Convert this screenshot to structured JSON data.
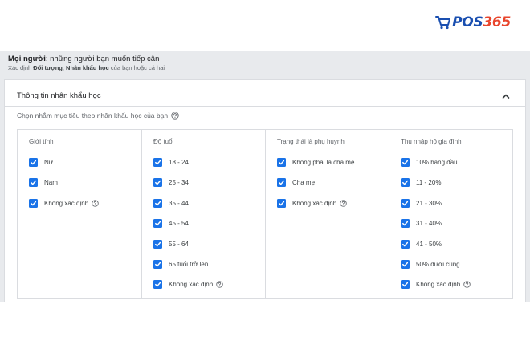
{
  "logo": {
    "prefix": "POS",
    "suffix": "365",
    "colors": {
      "prefix": "#1a4fb0",
      "suffix": "#e8452c"
    },
    "icon": "shopping-cart-icon"
  },
  "header": {
    "title_bold": "Mọi người",
    "title_rest": ": những người bạn muốn tiếp cận",
    "sub_pre": "Xác định ",
    "sub_bold1": "Đối tượng",
    "sub_mid": ", ",
    "sub_bold2": "Nhân khẩu học",
    "sub_post": " của bạn hoặc cả hai"
  },
  "card": {
    "title": "Thông tin nhân khẩu học",
    "collapse_icon": "chevron-up-icon",
    "prompt": "Chọn nhắm mục tiêu theo nhân khẩu học của bạn",
    "help_icon": "help-circle-icon"
  },
  "columns": [
    {
      "header": "Giới tính",
      "options": [
        {
          "label": "Nữ",
          "checked": true,
          "help": false
        },
        {
          "label": "Nam",
          "checked": true,
          "help": false
        },
        {
          "label": "Không xác định",
          "checked": true,
          "help": true
        }
      ]
    },
    {
      "header": "Độ tuổi",
      "options": [
        {
          "label": "18 - 24",
          "checked": true,
          "help": false
        },
        {
          "label": "25 - 34",
          "checked": true,
          "help": false
        },
        {
          "label": "35 - 44",
          "checked": true,
          "help": false
        },
        {
          "label": "45 - 54",
          "checked": true,
          "help": false
        },
        {
          "label": "55 - 64",
          "checked": true,
          "help": false
        },
        {
          "label": "65 tuổi trở lên",
          "checked": true,
          "help": false
        },
        {
          "label": "Không xác định",
          "checked": true,
          "help": true
        }
      ]
    },
    {
      "header": "Trạng thái là phụ huynh",
      "options": [
        {
          "label": "Không phải là cha mẹ",
          "checked": true,
          "help": false
        },
        {
          "label": "Cha mẹ",
          "checked": true,
          "help": false
        },
        {
          "label": "Không xác định",
          "checked": true,
          "help": true
        }
      ]
    },
    {
      "header": "Thu nhập hộ gia đình",
      "options": [
        {
          "label": "10% hàng đầu",
          "checked": true,
          "help": false
        },
        {
          "label": "11 - 20%",
          "checked": true,
          "help": false
        },
        {
          "label": "21 - 30%",
          "checked": true,
          "help": false
        },
        {
          "label": "31 - 40%",
          "checked": true,
          "help": false
        },
        {
          "label": "41 - 50%",
          "checked": true,
          "help": false
        },
        {
          "label": "50% dưới cùng",
          "checked": true,
          "help": false
        },
        {
          "label": "Không xác định",
          "checked": true,
          "help": true
        }
      ]
    }
  ],
  "colors": {
    "checkbox": "#1a73e8",
    "frame_bg": "#e8eaed",
    "border": "#dadce0"
  }
}
